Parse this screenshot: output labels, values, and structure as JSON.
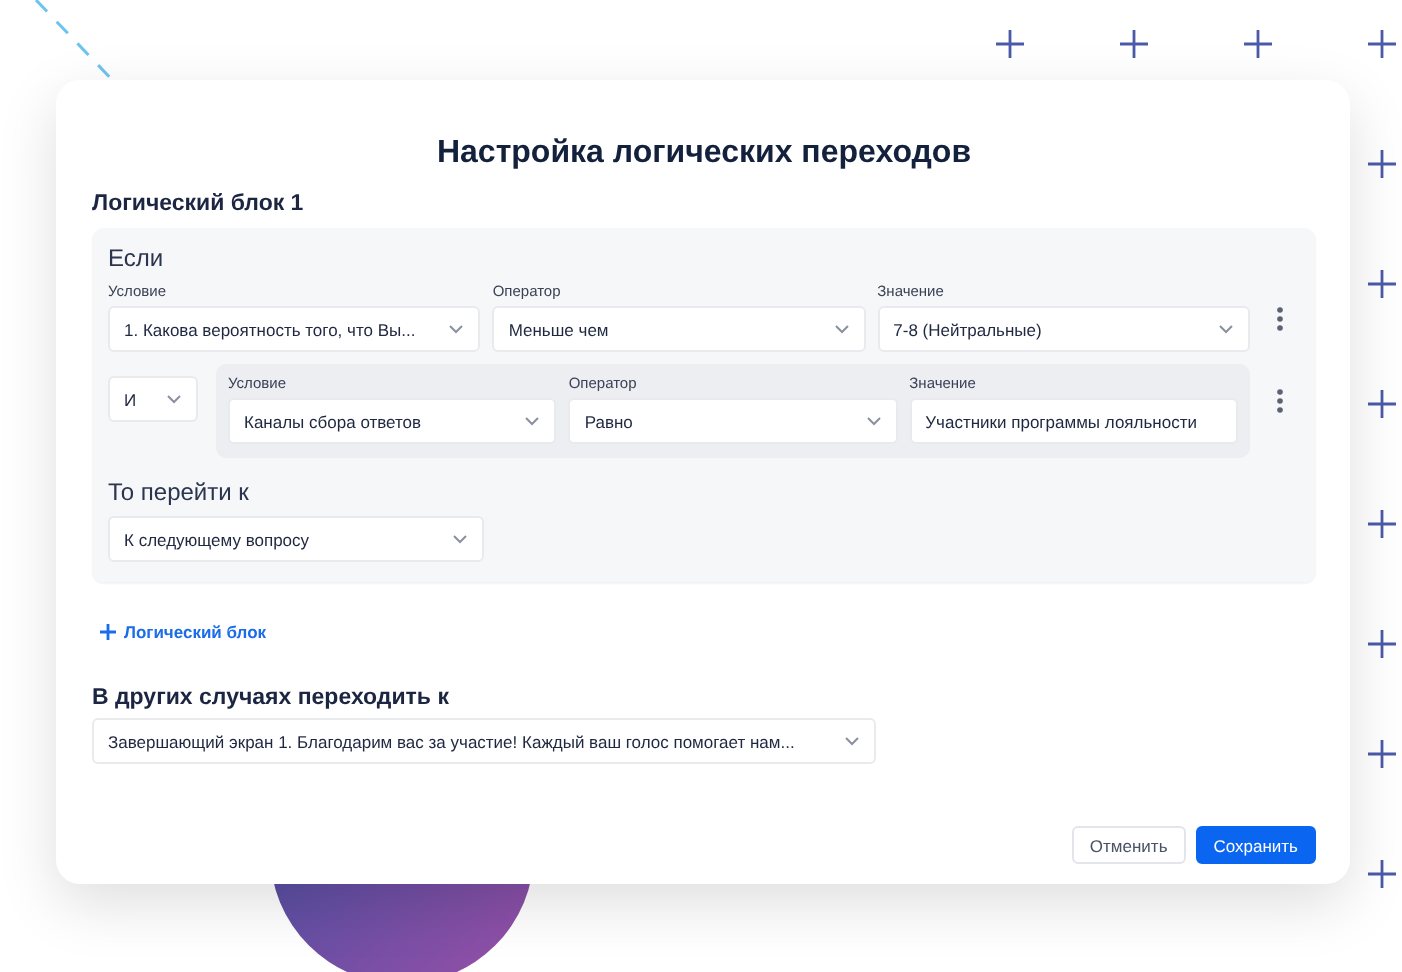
{
  "dialog": {
    "title": "Настройка логических переходов"
  },
  "blocks": [
    {
      "title": "Логический блок 1",
      "if_label": "Если",
      "conditions": [
        {
          "fields": [
            {
              "kind": "select",
              "label": "Условие",
              "value": "1. Какова вероятность того, что Вы..."
            },
            {
              "kind": "select",
              "label": "Оператор",
              "value": "Меньше чем"
            },
            {
              "kind": "select",
              "label": "Значение",
              "value": "7-8 (Нейтральные)"
            }
          ]
        },
        {
          "connector": "И",
          "fields": [
            {
              "kind": "select",
              "label": "Условие",
              "value": "Каналы сбора ответов"
            },
            {
              "kind": "select",
              "label": "Оператор",
              "value": "Равно"
            },
            {
              "kind": "input",
              "label": "Значение",
              "value": "Участники программы лояльности"
            }
          ]
        }
      ],
      "then_label": "То перейти к",
      "then_value": "К следующему вопросу"
    }
  ],
  "add_block": "Логический блок",
  "otherwise": {
    "label": "В других случаях переходить к",
    "value": "Завершающий экран 1. Благодарим вас за участие! Каждый ваш голос помогает нам..."
  },
  "buttons": [
    {
      "kind": "secondary",
      "label": "Отменить"
    },
    {
      "kind": "primary",
      "label": "Сохранить"
    }
  ]
}
